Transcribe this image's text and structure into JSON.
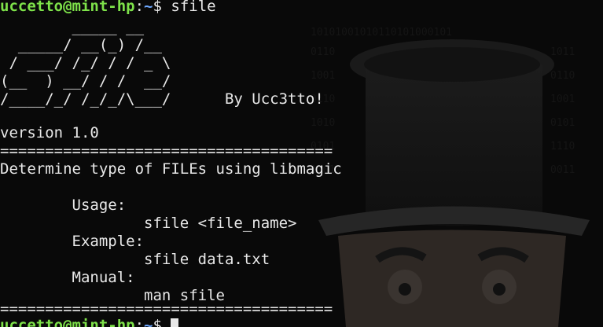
{
  "prompt": {
    "user_host": "uccetto@mint-hp",
    "sep": ":",
    "path": "~",
    "symbol": "$",
    "command": "sfile"
  },
  "banner": {
    "line1": "        _____ __",
    "line2": "  _____/ __(_) /__",
    "line3": " / ___/ /_/ / / _ \\",
    "line4": "(__  ) __/ / /  __/",
    "line5": "/____/_/ /_/_/\\___/      By Ucc3tto!"
  },
  "version": "version 1.0",
  "separator": "=====================================",
  "description": "Determine type of FILEs using libmagic",
  "usage_label": "        Usage:",
  "usage_value": "                sfile <file_name>",
  "example_label": "        Example:",
  "example_value": "                sfile data.txt",
  "manual_label": "        Manual:",
  "manual_value": "                man sfile",
  "bottom_separator": "=====================================",
  "next_prompt": {
    "user_host": "uccetto@mint-hp",
    "sep": ":",
    "path": "~",
    "symbol": "$ "
  }
}
